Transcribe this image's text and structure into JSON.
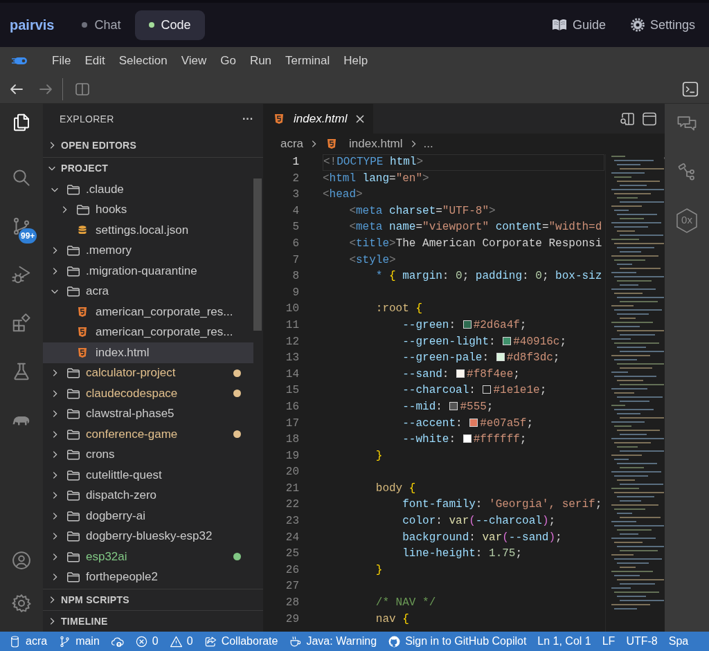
{
  "app_bar": {
    "brand": "pairvis",
    "tabs": [
      {
        "label": "Chat",
        "selected": false
      },
      {
        "label": "Code",
        "selected": true
      }
    ],
    "links": [
      {
        "kind": "guide",
        "label": "Guide"
      },
      {
        "kind": "settings",
        "label": "Settings"
      }
    ]
  },
  "menu_bar": {
    "items": [
      "File",
      "Edit",
      "Selection",
      "View",
      "Go",
      "Run",
      "Terminal",
      "Help"
    ]
  },
  "toolbar": {
    "nav": [
      {
        "kind": "back",
        "disabled": false
      },
      {
        "kind": "forward",
        "disabled": true
      }
    ]
  },
  "activity_bar": {
    "items": [
      {
        "kind": "explorer",
        "selected": true
      },
      {
        "kind": "search",
        "selected": false
      },
      {
        "kind": "source-control",
        "selected": false,
        "badge": "99+"
      },
      {
        "kind": "run-debug",
        "selected": false
      },
      {
        "kind": "extensions",
        "selected": false
      },
      {
        "kind": "testing",
        "selected": false
      },
      {
        "kind": "gradle",
        "selected": false
      }
    ],
    "bottom": [
      {
        "kind": "account"
      },
      {
        "kind": "manage"
      }
    ]
  },
  "sidebar": {
    "title": "EXPLORER",
    "more": "···",
    "sections": [
      {
        "title": "OPEN EDITORS",
        "expanded": false
      },
      {
        "title": "PROJECT",
        "expanded": true,
        "children": [
          {
            "name": ".claude",
            "kind": "folder",
            "expanded": true,
            "selected": false,
            "children": [
              {
                "name": "hooks",
                "kind": "folder",
                "expanded": false,
                "selected": false
              },
              {
                "name": "settings.local.json",
                "kind": "json",
                "selected": false
              }
            ]
          },
          {
            "name": ".memory",
            "kind": "folder",
            "expanded": false,
            "selected": false
          },
          {
            "name": ".migration-quarantine",
            "kind": "folder",
            "expanded": false,
            "selected": false
          },
          {
            "name": "acra",
            "kind": "folder",
            "expanded": true,
            "selected": false,
            "children": [
              {
                "name": "american_corporate_res...",
                "kind": "html",
                "selected": false
              },
              {
                "name": "american_corporate_res...",
                "kind": "html",
                "selected": false
              },
              {
                "name": "index.html",
                "kind": "html",
                "selected": true
              }
            ]
          },
          {
            "name": "calculator-project",
            "kind": "folder",
            "expanded": false,
            "selected": false,
            "color": "#e2c08d"
          },
          {
            "name": "claudecodespace",
            "kind": "folder",
            "expanded": false,
            "selected": false,
            "color": "#e2c08d"
          },
          {
            "name": "clawstral-phase5",
            "kind": "folder",
            "expanded": false,
            "selected": false
          },
          {
            "name": "conference-game",
            "kind": "folder",
            "expanded": false,
            "selected": false,
            "color": "#e2c08d"
          },
          {
            "name": "crons",
            "kind": "folder",
            "expanded": false,
            "selected": false
          },
          {
            "name": "cutelittle-quest",
            "kind": "folder",
            "expanded": false,
            "selected": false
          },
          {
            "name": "dispatch-zero",
            "kind": "folder",
            "expanded": false,
            "selected": false
          },
          {
            "name": "dogberry-ai",
            "kind": "folder",
            "expanded": false,
            "selected": false
          },
          {
            "name": "dogberry-bluesky-esp32",
            "kind": "folder",
            "expanded": false,
            "selected": false
          },
          {
            "name": "esp32ai",
            "kind": "folder",
            "expanded": false,
            "selected": false,
            "color": "#81c784"
          },
          {
            "name": "forthepeople2",
            "kind": "folder",
            "expanded": false,
            "selected": false
          }
        ]
      },
      {
        "title": "NPM SCRIPTS",
        "expanded": false
      },
      {
        "title": "TIMELINE",
        "expanded": false
      }
    ]
  },
  "editor": {
    "tabs": [
      {
        "label": "index.html",
        "kind": "html",
        "preview": true
      }
    ],
    "breadcrumbs": [
      {
        "kind": "folder",
        "label": "acra"
      },
      {
        "kind": "html",
        "label": "index.html"
      },
      {
        "kind": "more",
        "label": "..."
      }
    ],
    "lines": [
      {
        "number": "1",
        "current": true,
        "tokens": [
          {
            "kind": "punct",
            "text": "<!"
          },
          {
            "kind": "tag",
            "text": "DOCTYPE"
          },
          {
            "kind": "attr",
            "text": " html"
          },
          {
            "kind": "punct",
            "text": ">"
          }
        ]
      },
      {
        "number": "2",
        "current": false,
        "tokens": [
          {
            "kind": "punct",
            "text": "<"
          },
          {
            "kind": "tag",
            "text": "html"
          },
          {
            "kind": "attr",
            "text": " lang"
          },
          {
            "kind": "text",
            "text": "="
          },
          {
            "kind": "string",
            "text": "\"en\""
          },
          {
            "kind": "punct",
            "text": ">"
          }
        ]
      },
      {
        "number": "3",
        "current": false,
        "tokens": [
          {
            "kind": "punct",
            "text": "<"
          },
          {
            "kind": "tag",
            "text": "head"
          },
          {
            "kind": "punct",
            "text": ">"
          }
        ]
      },
      {
        "number": "4",
        "current": false,
        "tokens": [
          {
            "kind": "punct",
            "text": "    <"
          },
          {
            "kind": "tag",
            "text": "meta"
          },
          {
            "kind": "attr",
            "text": " charset"
          },
          {
            "kind": "text",
            "text": "="
          },
          {
            "kind": "string",
            "text": "\"UTF-8\""
          },
          {
            "kind": "punct",
            "text": ">"
          }
        ]
      },
      {
        "number": "5",
        "current": false,
        "tokens": [
          {
            "kind": "punct",
            "text": "    <"
          },
          {
            "kind": "tag",
            "text": "meta"
          },
          {
            "kind": "attr",
            "text": " name"
          },
          {
            "kind": "text",
            "text": "="
          },
          {
            "kind": "string",
            "text": "\"viewport\""
          },
          {
            "kind": "attr",
            "text": " content"
          },
          {
            "kind": "text",
            "text": "="
          },
          {
            "kind": "string",
            "text": "\"width=d"
          }
        ]
      },
      {
        "number": "6",
        "current": false,
        "tokens": [
          {
            "kind": "punct",
            "text": "    <"
          },
          {
            "kind": "tag",
            "text": "title"
          },
          {
            "kind": "punct",
            "text": ">"
          },
          {
            "kind": "text",
            "text": "The American Corporate Responsi"
          }
        ]
      },
      {
        "number": "7",
        "current": false,
        "tokens": [
          {
            "kind": "punct",
            "text": "    <"
          },
          {
            "kind": "tag",
            "text": "style"
          },
          {
            "kind": "punct",
            "text": ">"
          }
        ]
      },
      {
        "number": "8",
        "current": false,
        "tokens": [
          {
            "kind": "universal",
            "text": "        *"
          },
          {
            "kind": "brace",
            "text": " {"
          },
          {
            "kind": "prop",
            "text": " margin"
          },
          {
            "kind": "text",
            "text": ": "
          },
          {
            "kind": "number",
            "text": "0"
          },
          {
            "kind": "text",
            "text": "; "
          },
          {
            "kind": "prop",
            "text": "padding"
          },
          {
            "kind": "text",
            "text": ": "
          },
          {
            "kind": "number",
            "text": "0"
          },
          {
            "kind": "text",
            "text": "; "
          },
          {
            "kind": "prop",
            "text": "box-siz"
          }
        ]
      },
      {
        "number": "9",
        "current": false
      },
      {
        "number": "10",
        "current": false,
        "tokens": [
          {
            "kind": "selector",
            "text": "        :root"
          },
          {
            "kind": "brace",
            "text": " {"
          }
        ]
      },
      {
        "number": "11",
        "current": false,
        "tokens": [
          {
            "kind": "prop",
            "text": "            --green"
          },
          {
            "kind": "text",
            "text": ": "
          },
          {
            "kind": "swatch",
            "color": "#2d6a4f"
          },
          {
            "kind": "value",
            "text": "#2d6a4f"
          },
          {
            "kind": "text",
            "text": ";"
          }
        ]
      },
      {
        "number": "12",
        "current": false,
        "tokens": [
          {
            "kind": "prop",
            "text": "            --green-light"
          },
          {
            "kind": "text",
            "text": ": "
          },
          {
            "kind": "swatch",
            "color": "#40916c"
          },
          {
            "kind": "value",
            "text": "#40916c"
          },
          {
            "kind": "text",
            "text": ";"
          }
        ]
      },
      {
        "number": "13",
        "current": false,
        "tokens": [
          {
            "kind": "prop",
            "text": "            --green-pale"
          },
          {
            "kind": "text",
            "text": ": "
          },
          {
            "kind": "swatch",
            "color": "#d8f3dc"
          },
          {
            "kind": "value",
            "text": "#d8f3dc"
          },
          {
            "kind": "text",
            "text": ";"
          }
        ]
      },
      {
        "number": "14",
        "current": false,
        "tokens": [
          {
            "kind": "prop",
            "text": "            --sand"
          },
          {
            "kind": "text",
            "text": ": "
          },
          {
            "kind": "swatch",
            "color": "#f8f4ee"
          },
          {
            "kind": "value",
            "text": "#f8f4ee"
          },
          {
            "kind": "text",
            "text": ";"
          }
        ]
      },
      {
        "number": "15",
        "current": false,
        "tokens": [
          {
            "kind": "prop",
            "text": "            --charcoal"
          },
          {
            "kind": "text",
            "text": ": "
          },
          {
            "kind": "swatch",
            "color": "#1e1e1e"
          },
          {
            "kind": "value",
            "text": "#1e1e1e"
          },
          {
            "kind": "text",
            "text": ";"
          }
        ]
      },
      {
        "number": "16",
        "current": false,
        "tokens": [
          {
            "kind": "prop",
            "text": "            --mid"
          },
          {
            "kind": "text",
            "text": ": "
          },
          {
            "kind": "swatch",
            "color": "#555555"
          },
          {
            "kind": "value",
            "text": "#555"
          },
          {
            "kind": "text",
            "text": ";"
          }
        ]
      },
      {
        "number": "17",
        "current": false,
        "tokens": [
          {
            "kind": "prop",
            "text": "            --accent"
          },
          {
            "kind": "text",
            "text": ": "
          },
          {
            "kind": "swatch",
            "color": "#e07a5f"
          },
          {
            "kind": "value",
            "text": "#e07a5f"
          },
          {
            "kind": "text",
            "text": ";"
          }
        ]
      },
      {
        "number": "18",
        "current": false,
        "tokens": [
          {
            "kind": "prop",
            "text": "            --white"
          },
          {
            "kind": "text",
            "text": ": "
          },
          {
            "kind": "swatch",
            "color": "#ffffff"
          },
          {
            "kind": "value",
            "text": "#ffffff"
          },
          {
            "kind": "text",
            "text": ";"
          }
        ]
      },
      {
        "number": "19",
        "current": false,
        "tokens": [
          {
            "kind": "brace",
            "text": "        }"
          }
        ]
      },
      {
        "number": "20",
        "current": false
      },
      {
        "number": "21",
        "current": false,
        "tokens": [
          {
            "kind": "selector",
            "text": "        body"
          },
          {
            "kind": "brace",
            "text": " {"
          }
        ]
      },
      {
        "number": "22",
        "current": false,
        "tokens": [
          {
            "kind": "prop",
            "text": "            font-family"
          },
          {
            "kind": "text",
            "text": ": "
          },
          {
            "kind": "value",
            "text": "'Georgia', serif"
          },
          {
            "kind": "text",
            "text": ";"
          }
        ]
      },
      {
        "number": "23",
        "current": false,
        "tokens": [
          {
            "kind": "prop",
            "text": "            color"
          },
          {
            "kind": "text",
            "text": ": "
          },
          {
            "kind": "func",
            "text": "var"
          },
          {
            "kind": "paren",
            "text": "("
          },
          {
            "kind": "prop",
            "text": "--charcoal"
          },
          {
            "kind": "paren",
            "text": ")"
          },
          {
            "kind": "text",
            "text": ";"
          }
        ]
      },
      {
        "number": "24",
        "current": false,
        "tokens": [
          {
            "kind": "prop",
            "text": "            background"
          },
          {
            "kind": "text",
            "text": ": "
          },
          {
            "kind": "func",
            "text": "var"
          },
          {
            "kind": "paren",
            "text": "("
          },
          {
            "kind": "prop",
            "text": "--sand"
          },
          {
            "kind": "paren",
            "text": ")"
          },
          {
            "kind": "text",
            "text": ";"
          }
        ]
      },
      {
        "number": "25",
        "current": false,
        "tokens": [
          {
            "kind": "prop",
            "text": "            line-height"
          },
          {
            "kind": "text",
            "text": ": "
          },
          {
            "kind": "number",
            "text": "1.75"
          },
          {
            "kind": "text",
            "text": ";"
          }
        ]
      },
      {
        "number": "26",
        "current": false,
        "tokens": [
          {
            "kind": "brace",
            "text": "        }"
          }
        ]
      },
      {
        "number": "27",
        "current": false
      },
      {
        "number": "28",
        "current": false,
        "tokens": [
          {
            "kind": "comment",
            "text": "        /* NAV */"
          }
        ]
      },
      {
        "number": "29",
        "current": false,
        "tokens": [
          {
            "kind": "selector",
            "text": "        nav"
          },
          {
            "kind": "brace",
            "text": " {"
          }
        ]
      }
    ]
  },
  "right_bar": {
    "items": [
      {
        "kind": "chat"
      },
      {
        "kind": "tool"
      },
      {
        "kind": "hex",
        "label": "0x"
      }
    ]
  },
  "status_bar": {
    "items": [
      {
        "kind": "database",
        "text": "acra"
      },
      {
        "kind": "branch",
        "text": "main"
      },
      {
        "kind": "sync"
      },
      {
        "kind": "errors",
        "text": "0"
      },
      {
        "kind": "warnings",
        "text": "0"
      },
      {
        "kind": "share",
        "text": "Collaborate"
      },
      {
        "kind": "java",
        "text": "Java: Warning"
      },
      {
        "kind": "copilot",
        "text": "Sign in to GitHub Copilot"
      },
      {
        "kind": "plain",
        "text": "Ln 1, Col 1"
      },
      {
        "kind": "plain",
        "text": "LF"
      },
      {
        "kind": "plain",
        "text": "UTF-8"
      },
      {
        "kind": "plain",
        "text": "Spa"
      }
    ]
  }
}
